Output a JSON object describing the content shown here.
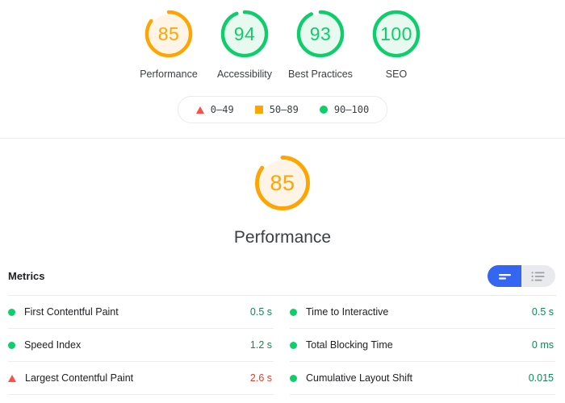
{
  "colors": {
    "pass": "#0cce6b",
    "average": "#ffa400",
    "fail": "#ff4e42",
    "accent_blue": "#3367f2"
  },
  "summary": {
    "gauges": [
      {
        "score": "85",
        "label": "Performance",
        "rating": "average"
      },
      {
        "score": "94",
        "label": "Accessibility",
        "rating": "pass"
      },
      {
        "score": "93",
        "label": "Best Practices",
        "rating": "pass"
      },
      {
        "score": "100",
        "label": "SEO",
        "rating": "pass"
      }
    ]
  },
  "legend": {
    "items": [
      {
        "icon": "warning-triangle-icon",
        "range": "0–49"
      },
      {
        "icon": "average-square-icon",
        "range": "50–89"
      },
      {
        "icon": "pass-circle-icon",
        "range": "90–100"
      }
    ]
  },
  "performance_section": {
    "gauge": {
      "score": "85",
      "rating": "average"
    },
    "title": "Performance"
  },
  "metrics": {
    "header": "Metrics",
    "toggle": {
      "options": [
        {
          "name": "filmstrip-view-toggle",
          "selected": true
        },
        {
          "name": "list-view-toggle",
          "selected": false
        }
      ]
    },
    "left_column": [
      {
        "name": "First Contentful Paint",
        "value": "0.5 s",
        "rating": "pass"
      },
      {
        "name": "Speed Index",
        "value": "1.2 s",
        "rating": "pass"
      },
      {
        "name": "Largest Contentful Paint",
        "value": "2.6 s",
        "rating": "fail"
      }
    ],
    "right_column": [
      {
        "name": "Time to Interactive",
        "value": "0.5 s",
        "rating": "pass"
      },
      {
        "name": "Total Blocking Time",
        "value": "0 ms",
        "rating": "pass"
      },
      {
        "name": "Cumulative Layout Shift",
        "value": "0.015",
        "rating": "pass"
      }
    ]
  }
}
